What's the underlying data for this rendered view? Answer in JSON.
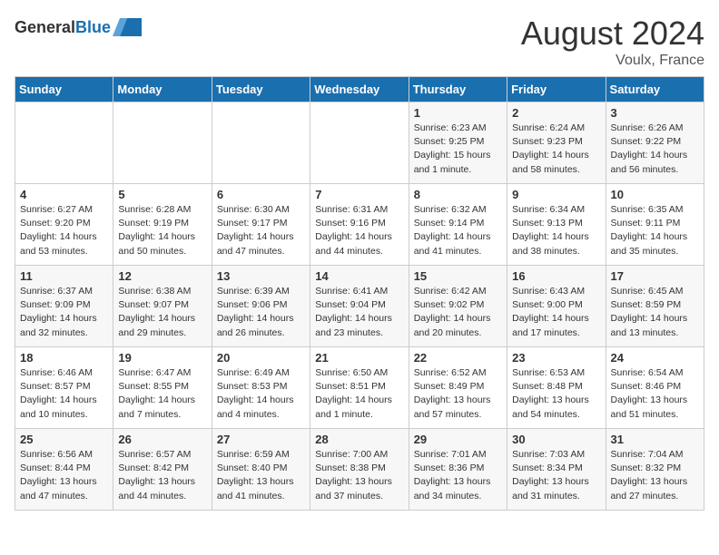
{
  "header": {
    "logo_general": "General",
    "logo_blue": "Blue",
    "month_year": "August 2024",
    "location": "Voulx, France"
  },
  "days_of_week": [
    "Sunday",
    "Monday",
    "Tuesday",
    "Wednesday",
    "Thursday",
    "Friday",
    "Saturday"
  ],
  "weeks": [
    [
      {
        "day": "",
        "info": ""
      },
      {
        "day": "",
        "info": ""
      },
      {
        "day": "",
        "info": ""
      },
      {
        "day": "",
        "info": ""
      },
      {
        "day": "1",
        "info": "Sunrise: 6:23 AM\nSunset: 9:25 PM\nDaylight: 15 hours and 1 minute."
      },
      {
        "day": "2",
        "info": "Sunrise: 6:24 AM\nSunset: 9:23 PM\nDaylight: 14 hours and 58 minutes."
      },
      {
        "day": "3",
        "info": "Sunrise: 6:26 AM\nSunset: 9:22 PM\nDaylight: 14 hours and 56 minutes."
      }
    ],
    [
      {
        "day": "4",
        "info": "Sunrise: 6:27 AM\nSunset: 9:20 PM\nDaylight: 14 hours and 53 minutes."
      },
      {
        "day": "5",
        "info": "Sunrise: 6:28 AM\nSunset: 9:19 PM\nDaylight: 14 hours and 50 minutes."
      },
      {
        "day": "6",
        "info": "Sunrise: 6:30 AM\nSunset: 9:17 PM\nDaylight: 14 hours and 47 minutes."
      },
      {
        "day": "7",
        "info": "Sunrise: 6:31 AM\nSunset: 9:16 PM\nDaylight: 14 hours and 44 minutes."
      },
      {
        "day": "8",
        "info": "Sunrise: 6:32 AM\nSunset: 9:14 PM\nDaylight: 14 hours and 41 minutes."
      },
      {
        "day": "9",
        "info": "Sunrise: 6:34 AM\nSunset: 9:13 PM\nDaylight: 14 hours and 38 minutes."
      },
      {
        "day": "10",
        "info": "Sunrise: 6:35 AM\nSunset: 9:11 PM\nDaylight: 14 hours and 35 minutes."
      }
    ],
    [
      {
        "day": "11",
        "info": "Sunrise: 6:37 AM\nSunset: 9:09 PM\nDaylight: 14 hours and 32 minutes."
      },
      {
        "day": "12",
        "info": "Sunrise: 6:38 AM\nSunset: 9:07 PM\nDaylight: 14 hours and 29 minutes."
      },
      {
        "day": "13",
        "info": "Sunrise: 6:39 AM\nSunset: 9:06 PM\nDaylight: 14 hours and 26 minutes."
      },
      {
        "day": "14",
        "info": "Sunrise: 6:41 AM\nSunset: 9:04 PM\nDaylight: 14 hours and 23 minutes."
      },
      {
        "day": "15",
        "info": "Sunrise: 6:42 AM\nSunset: 9:02 PM\nDaylight: 14 hours and 20 minutes."
      },
      {
        "day": "16",
        "info": "Sunrise: 6:43 AM\nSunset: 9:00 PM\nDaylight: 14 hours and 17 minutes."
      },
      {
        "day": "17",
        "info": "Sunrise: 6:45 AM\nSunset: 8:59 PM\nDaylight: 14 hours and 13 minutes."
      }
    ],
    [
      {
        "day": "18",
        "info": "Sunrise: 6:46 AM\nSunset: 8:57 PM\nDaylight: 14 hours and 10 minutes."
      },
      {
        "day": "19",
        "info": "Sunrise: 6:47 AM\nSunset: 8:55 PM\nDaylight: 14 hours and 7 minutes."
      },
      {
        "day": "20",
        "info": "Sunrise: 6:49 AM\nSunset: 8:53 PM\nDaylight: 14 hours and 4 minutes."
      },
      {
        "day": "21",
        "info": "Sunrise: 6:50 AM\nSunset: 8:51 PM\nDaylight: 14 hours and 1 minute."
      },
      {
        "day": "22",
        "info": "Sunrise: 6:52 AM\nSunset: 8:49 PM\nDaylight: 13 hours and 57 minutes."
      },
      {
        "day": "23",
        "info": "Sunrise: 6:53 AM\nSunset: 8:48 PM\nDaylight: 13 hours and 54 minutes."
      },
      {
        "day": "24",
        "info": "Sunrise: 6:54 AM\nSunset: 8:46 PM\nDaylight: 13 hours and 51 minutes."
      }
    ],
    [
      {
        "day": "25",
        "info": "Sunrise: 6:56 AM\nSunset: 8:44 PM\nDaylight: 13 hours and 47 minutes."
      },
      {
        "day": "26",
        "info": "Sunrise: 6:57 AM\nSunset: 8:42 PM\nDaylight: 13 hours and 44 minutes."
      },
      {
        "day": "27",
        "info": "Sunrise: 6:59 AM\nSunset: 8:40 PM\nDaylight: 13 hours and 41 minutes."
      },
      {
        "day": "28",
        "info": "Sunrise: 7:00 AM\nSunset: 8:38 PM\nDaylight: 13 hours and 37 minutes."
      },
      {
        "day": "29",
        "info": "Sunrise: 7:01 AM\nSunset: 8:36 PM\nDaylight: 13 hours and 34 minutes."
      },
      {
        "day": "30",
        "info": "Sunrise: 7:03 AM\nSunset: 8:34 PM\nDaylight: 13 hours and 31 minutes."
      },
      {
        "day": "31",
        "info": "Sunrise: 7:04 AM\nSunset: 8:32 PM\nDaylight: 13 hours and 27 minutes."
      }
    ]
  ]
}
